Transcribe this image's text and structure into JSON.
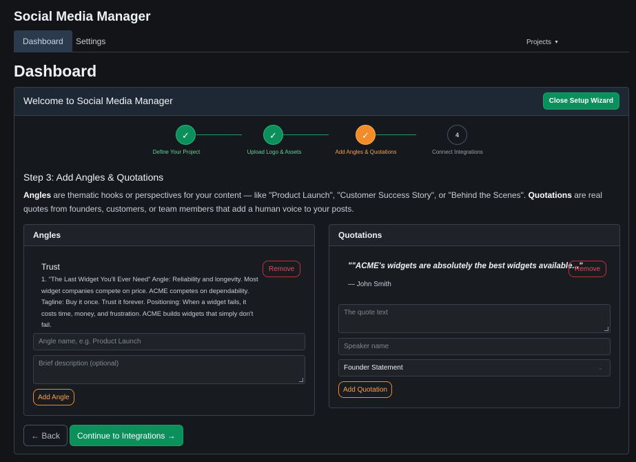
{
  "app": {
    "title": "Social Media Manager"
  },
  "nav": {
    "tabs": [
      {
        "label": "Dashboard"
      },
      {
        "label": "Settings"
      }
    ],
    "projects_label": "Projects"
  },
  "page": {
    "title": "Dashboard"
  },
  "wizard": {
    "title": "Welcome to Social Media Manager",
    "close_label": "Close Setup Wizard",
    "steps": [
      {
        "label": "Define Your Project",
        "status": "done"
      },
      {
        "label": "Upload Logo & Assets",
        "status": "done"
      },
      {
        "label": "Add Angles & Quotations",
        "status": "current"
      },
      {
        "label": "Connect Integrations",
        "status": "pending",
        "number": "4"
      }
    ],
    "step_heading": "Step 3: Add Angles & Quotations",
    "description": {
      "angles_term": "Angles",
      "angles_text": " are thematic hooks or perspectives for your content — like \"Product Launch\", \"Customer Success Story\", or \"Behind the Scenes\". ",
      "quotations_term": "Quotations",
      "quotations_text": " are real quotes from founders, customers, or team members that add a human voice to your posts."
    },
    "angles": {
      "header": "Angles",
      "items": [
        {
          "name": "Trust",
          "description": "1. \"The Last Widget You'll Ever Need\" Angle: Reliability and longevity. Most widget companies compete on price. ACME competes on dependability. Tagline: Buy it once. Trust it forever. Positioning: When a widget fails, it costs time, money, and frustration. ACME builds widgets that simply don't fail.",
          "remove_label": "Remove"
        }
      ],
      "name_placeholder": "Angle name, e.g. Product Launch",
      "description_placeholder": "Brief description (optional)",
      "add_label": "Add Angle"
    },
    "quotations": {
      "header": "Quotations",
      "items": [
        {
          "text": "\"\"ACME's widgets are absolutely the best widgets available...\"",
          "author": "— John Smith",
          "remove_label": "Remove"
        }
      ],
      "quote_placeholder": "The quote text",
      "speaker_placeholder": "Speaker name",
      "type_selected": "Founder Statement",
      "add_label": "Add Quotation"
    },
    "back_label": "← Back",
    "continue_label": "Continue to Integrations →"
  },
  "colors": {
    "background": "#121417",
    "success": "#0b8f5b",
    "accent": "#f28c28",
    "danger": "#c5303f",
    "nav_active": "#2b3a4d"
  },
  "icons": {
    "step_done": "checkmark-icon",
    "caret": "caret-down-icon",
    "select": "chevron-down-icon"
  }
}
